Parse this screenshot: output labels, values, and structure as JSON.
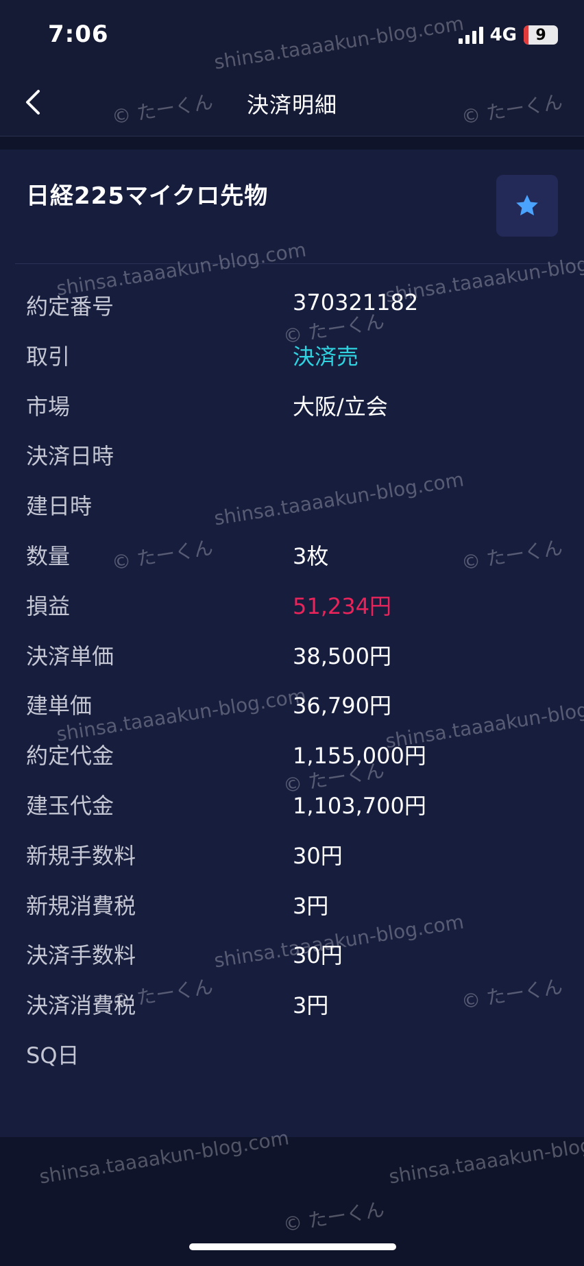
{
  "status_bar": {
    "time": "7:06",
    "network": "4G",
    "battery": "9"
  },
  "nav": {
    "title": "決済明細"
  },
  "product": {
    "name": "日経225マイクロ先物"
  },
  "colors": {
    "background": "#151a35",
    "card": "#171d3d",
    "profit": "#e8245a",
    "trade_type": "#2fd3e0",
    "favorite_star": "#4aa3ff"
  },
  "details": [
    {
      "label": "約定番号",
      "value": "370321182"
    },
    {
      "label": "取引",
      "value": "決済売"
    },
    {
      "label": "市場",
      "value": "大阪/立会"
    },
    {
      "label": "決済日時",
      "value": ""
    },
    {
      "label": "建日時",
      "value": ""
    },
    {
      "label": "数量",
      "value": "3枚"
    },
    {
      "label": "損益",
      "value": "51,234円"
    },
    {
      "label": "決済単価",
      "value": "38,500円"
    },
    {
      "label": "建単価",
      "value": "36,790円"
    },
    {
      "label": "約定代金",
      "value": "1,155,000円"
    },
    {
      "label": "建玉代金",
      "value": "1,103,700円"
    },
    {
      "label": "新規手数料",
      "value": "30円"
    },
    {
      "label": "新規消費税",
      "value": "3円"
    },
    {
      "label": "決済手数料",
      "value": "30円"
    },
    {
      "label": "決済消費税",
      "value": "3円"
    },
    {
      "label": "SQ日",
      "value": ""
    }
  ],
  "watermark": {
    "site": "shinsa.taaaakun-blog.com",
    "author": "© たーくん"
  }
}
